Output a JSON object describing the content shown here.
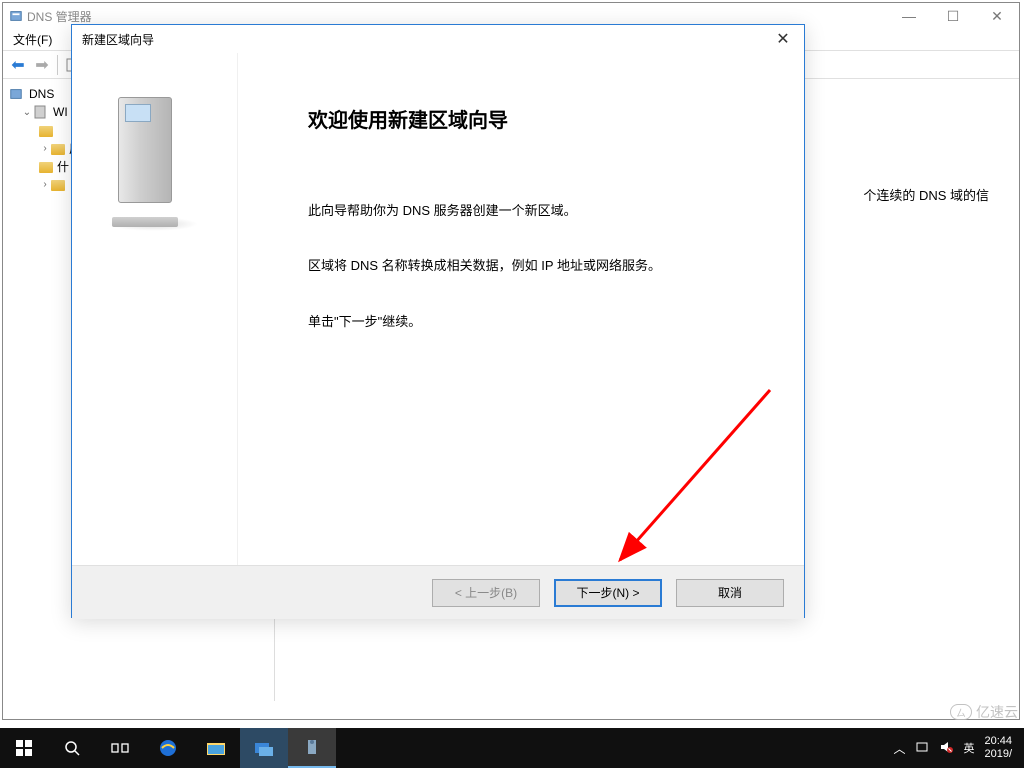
{
  "main": {
    "title": "DNS 管理器",
    "menus": {
      "file": "文件(F)"
    },
    "window_controls": {
      "min": "—",
      "max": "☐",
      "close": "✕"
    }
  },
  "tree": {
    "root": "DNS",
    "server": "WI",
    "folders": [
      "",
      "厂",
      "什",
      ""
    ]
  },
  "content": {
    "visible_text": "个连续的 DNS 域的信"
  },
  "wizard": {
    "title": "新建区域向导",
    "heading": "欢迎使用新建区域向导",
    "p1": "此向导帮助你为 DNS 服务器创建一个新区域。",
    "p2": "区域将 DNS 名称转换成相关数据，例如 IP 地址或网络服务。",
    "p3": "单击\"下一步\"继续。",
    "buttons": {
      "back": "< 上一步(B)",
      "next": "下一步(N) >",
      "cancel": "取消"
    },
    "close": "✕"
  },
  "tray": {
    "ime": "英",
    "time": "20:44",
    "date": "2019/"
  },
  "watermark": "亿速云"
}
